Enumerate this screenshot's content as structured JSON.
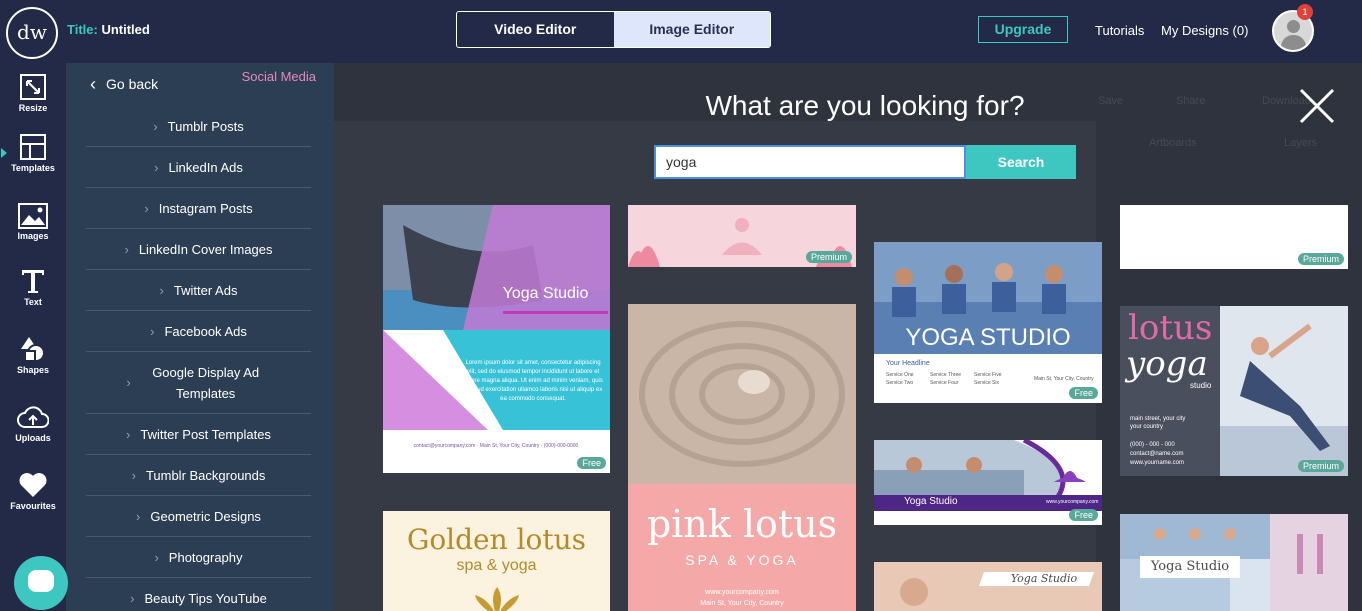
{
  "topbar": {
    "logo_text": "dw",
    "title_label": "Title:",
    "title_value": "Untitled",
    "modes": [
      "Video Editor",
      "Image Editor"
    ],
    "active_mode": "Image Editor",
    "upgrade_label": "Upgrade",
    "tutorials_label": "Tutorials",
    "my_designs_label": "My Designs (0)",
    "notification_count": "1"
  },
  "rail": {
    "items": [
      {
        "label": "Resize",
        "icon": "resize-icon"
      },
      {
        "label": "Templates",
        "icon": "templates-icon"
      },
      {
        "label": "Images",
        "icon": "image-icon"
      },
      {
        "label": "Text",
        "icon": "text-icon"
      },
      {
        "label": "Shapes",
        "icon": "shapes-icon"
      },
      {
        "label": "Uploads",
        "icon": "cloud-upload-icon"
      },
      {
        "label": "Favourites",
        "icon": "heart-icon"
      }
    ],
    "active": "Templates",
    "accent": "#3ec7c0"
  },
  "panel": {
    "go_back": "Go back",
    "category": "Social Media",
    "items": [
      "Tumblr Posts",
      "LinkedIn Ads",
      "Instagram Posts",
      "LinkedIn Cover Images",
      "Twitter Ads",
      "Facebook Ads",
      "Google Display Ad Templates",
      "Twitter Post Templates",
      "Tumblr Backgrounds",
      "Geometric Designs",
      "Photography",
      "Beauty Tips YouTube"
    ]
  },
  "overlay": {
    "heading": "What are you looking for?",
    "search_value": "yoga",
    "search_button": "Search"
  },
  "templates": [
    {
      "badge": "Free",
      "title": "Yoga Studio",
      "body": "Lorem ipsum dolor sit amet, consectetur adipiscing elit, sed do eiusmod tempor incididunt ut labore et dolore magna aliqua. Ut enim ad minim veniam, quis nostrud exercitation ullamco laboris nisi ut aliquip ex ea commodo consequat.",
      "footer": "contact@yourcompany.com · Main St, Your City, Country · (000)-000-0000"
    },
    {
      "badge": "Premium"
    },
    {
      "title": "pink lotus",
      "subtitle": "SPA & YOGA",
      "footer": "www.yourcompany.com",
      "footer2": "Main St, Your City, Country"
    },
    {
      "badge": "Free",
      "title": "YOGA STUDIO",
      "headline": "Your Headline",
      "services": [
        "Service One",
        "Service Two",
        "Service Three",
        "Service Four",
        "Service Five",
        "Service Six"
      ],
      "address": "Main St, Your City, Country"
    },
    {
      "badge": "Free",
      "title": "Yoga Studio",
      "url": "www.yourcompany.com"
    },
    {
      "badge": "Premium"
    },
    {
      "badge": "Premium",
      "title": "lotus",
      "title2": "yoga",
      "subtitle": "studio",
      "address": "main street, your city",
      "country": "your country",
      "phone": "(000) - 000 - 000",
      "email": "contact@name.com",
      "web": "www.yourname.com"
    },
    {
      "title": "Golden lotus",
      "subtitle": "spa & yoga"
    },
    {
      "title": "Yoga Studio"
    },
    {
      "title": "Yoga Studio"
    }
  ],
  "ghost_toolbar": [
    "Save",
    "Share",
    "Download",
    "Artboards",
    "Layers"
  ]
}
